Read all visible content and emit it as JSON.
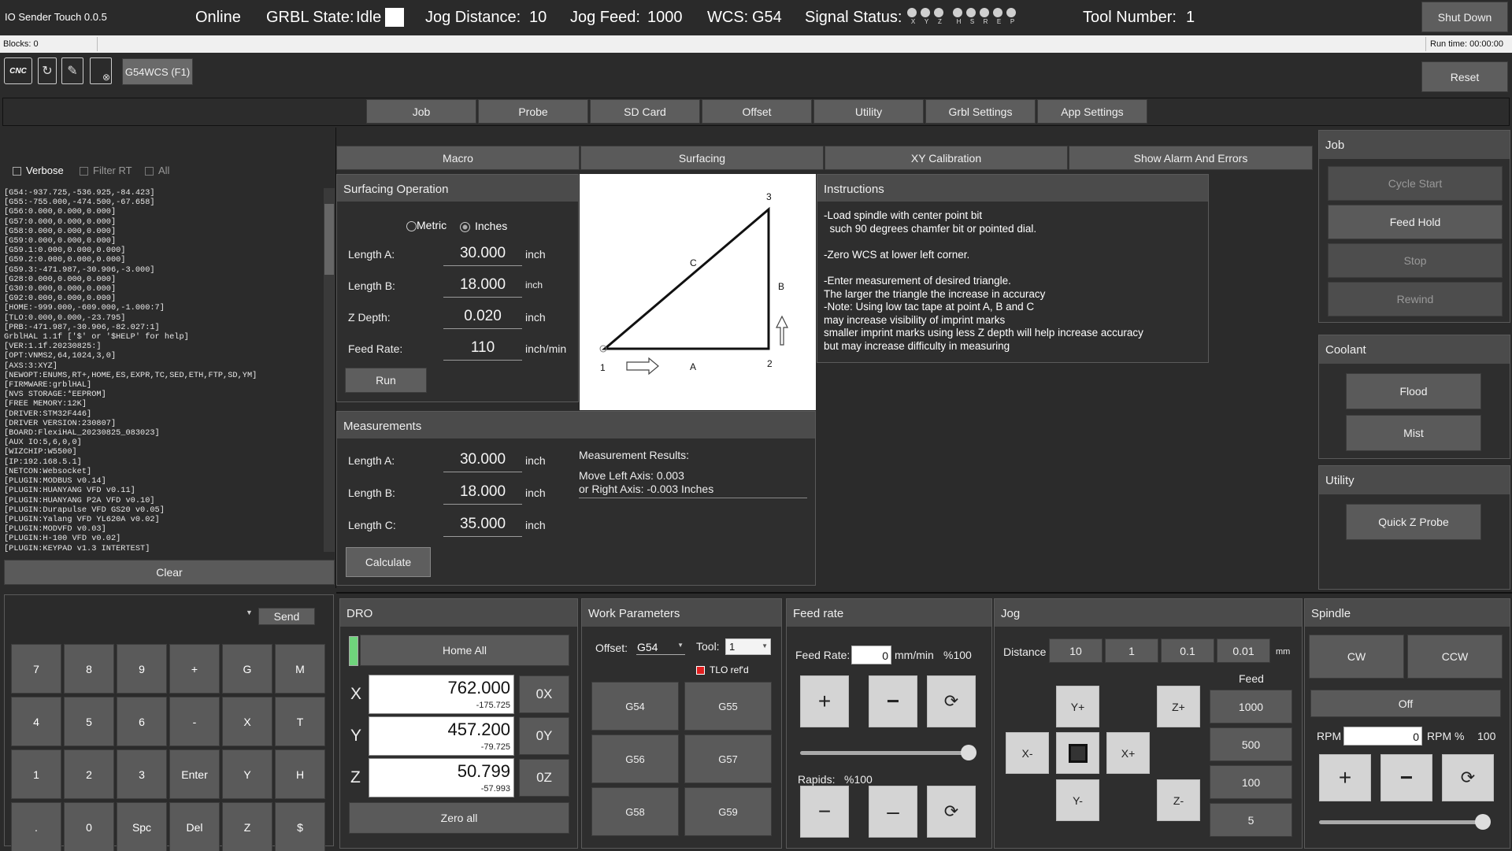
{
  "title_bar": {
    "app_title": "IO Sender Touch 0.0.5",
    "status": "Online",
    "grbl_label": "GRBL State:",
    "grbl_state": "Idle",
    "jog_dist_label": "Jog Distance:",
    "jog_dist": "10",
    "jog_feed_label": "Jog Feed:",
    "jog_feed": "1000",
    "wcs_label": "WCS:",
    "wcs": "G54",
    "signal_label": "Signal Status:",
    "signals_a": [
      "X",
      "Y",
      "Z"
    ],
    "signals_b": [
      "H",
      "S",
      "R",
      "E",
      "P"
    ],
    "tool_label": "Tool Number:",
    "tool": "1",
    "shutdown": "Shut Down"
  },
  "status_bar": {
    "blocks": "Blocks: 0",
    "runtime": "Run time: 00:00:00"
  },
  "toolbar": {
    "cnc_icon_text": "CNC",
    "wcs_button": "G54WCS (F1)",
    "reset": "Reset"
  },
  "main_tabs": [
    "Job",
    "Probe",
    "SD Card",
    "Offset",
    "Utility",
    "Grbl Settings",
    "App Settings"
  ],
  "sub_tabs": [
    "Macro",
    "Surfacing",
    "XY Calibration",
    "Show Alarm And Errors"
  ],
  "console": {
    "verbose": "Verbose",
    "filter": "Filter RT",
    "all": "All",
    "clear": "Clear",
    "send": "Send",
    "lines": [
      "[G54:-937.725,-536.925,-84.423]",
      "[G55:-755.000,-474.500,-67.658]",
      "[G56:0.000,0.000,0.000]",
      "[G57:0.000,0.000,0.000]",
      "[G58:0.000,0.000,0.000]",
      "[G59:0.000,0.000,0.000]",
      "[G59.1:0.000,0.000,0.000]",
      "[G59.2:0.000,0.000,0.000]",
      "[G59.3:-471.987,-30.906,-3.000]",
      "[G28:0.000,0.000,0.000]",
      "[G30:0.000,0.000,0.000]",
      "[G92:0.000,0.000,0.000]",
      "[HOME:-999.000,-609.000,-1.000:7]",
      "[TLO:0.000,0.000,-23.795]",
      "[PRB:-471.987,-30.906,-82.027:1]",
      "GrblHAL 1.1f ['$' or '$HELP' for help]",
      "[VER:1.1f.20230825:]",
      "[OPT:VNMS2,64,1024,3,0]",
      "[AXS:3:XYZ]",
      "[NEWOPT:ENUMS,RT+,HOME,ES,EXPR,TC,SED,ETH,FTP,SD,YM]",
      "[FIRMWARE:grblHAL]",
      "[NVS STORAGE:*EEPROM]",
      "[FREE MEMORY:12K]",
      "[DRIVER:STM32F446]",
      "[DRIVER VERSION:230807]",
      "[BOARD:FlexiHAL_20230825_083023]",
      "[AUX IO:5,6,0,0]",
      "[WIZCHIP:W5500]",
      "[IP:192.168.5.1]",
      "[NETCON:Websocket]",
      "[PLUGIN:MODBUS v0.14]",
      "[PLUGIN:HUANYANG VFD v0.11]",
      "[PLUGIN:HUANYANG P2A VFD v0.10]",
      "[PLUGIN:Durapulse VFD GS20 v0.05]",
      "[PLUGIN:Yalang VFD YL620A v0.02]",
      "[PLUGIN:MODVFD v0.03]",
      "[PLUGIN:H-100 VFD v0.02]",
      "[PLUGIN:KEYPAD v1.3 INTERTEST]"
    ]
  },
  "keypad": [
    "7",
    "8",
    "9",
    "+",
    "G",
    "M",
    "4",
    "5",
    "6",
    "-",
    "X",
    "T",
    "1",
    "2",
    "3",
    "Enter",
    "Y",
    "H",
    ".",
    "0",
    "Spc",
    "Del",
    "Z",
    "$"
  ],
  "surfacing": {
    "title": "Surfacing Operation",
    "metric": "Metric",
    "inches": "Inches",
    "fields": [
      {
        "label": "Length A:",
        "value": "30.000",
        "unit": "inch"
      },
      {
        "label": "Length B:",
        "value": "18.000",
        "unit": "inch"
      },
      {
        "label": "Z Depth:",
        "value": "0.020",
        "unit": "inch"
      },
      {
        "label": "Feed Rate:",
        "value": "110",
        "unit": "inch/min"
      }
    ],
    "run": "Run"
  },
  "diagram": {
    "p1": "1",
    "p2": "2",
    "p3": "3",
    "a": "A",
    "b": "B",
    "c": "C"
  },
  "instructions": {
    "title": "Instructions",
    "lines": [
      "-Load spindle with center point bit",
      "  such 90 degrees chamfer bit or pointed dial.",
      "",
      "-Zero WCS at lower left corner.",
      "",
      "-Enter measurement of desired triangle.",
      "The larger the triangle the increase in accuracy",
      "-Note: Using low tac tape at point A, B and C",
      "may increase visibility of imprint marks",
      "smaller imprint marks using less Z depth will help increase accuracy",
      "but may increase difficulty in measuring"
    ]
  },
  "measurements": {
    "title": "Measurements",
    "fields": [
      {
        "label": "Length A:",
        "value": "30.000",
        "unit": "inch"
      },
      {
        "label": "Length B:",
        "value": "18.000",
        "unit": "inch"
      },
      {
        "label": "Length C:",
        "value": "35.000",
        "unit": "inch"
      }
    ],
    "calculate": "Calculate",
    "results_title": "Measurement Results:",
    "result1": "Move Left Axis: 0.003",
    "result2": " or Right Axis: -0.003 Inches"
  },
  "job_panel": {
    "title": "Job",
    "cycle_start": "Cycle Start",
    "feed_hold": "Feed Hold",
    "stop": "Stop",
    "rewind": "Rewind"
  },
  "coolant_panel": {
    "title": "Coolant",
    "flood": "Flood",
    "mist": "Mist"
  },
  "utility_panel": {
    "title": "Utility",
    "quick_z": "Quick Z Probe"
  },
  "dro": {
    "title": "DRO",
    "home_all": "Home All",
    "zero_all": "Zero all",
    "axes": [
      {
        "name": "X",
        "value": "762.000",
        "sub": "-175.725",
        "zero": "0X"
      },
      {
        "name": "Y",
        "value": "457.200",
        "sub": "-79.725",
        "zero": "0Y"
      },
      {
        "name": "Z",
        "value": "50.799",
        "sub": "-57.993",
        "zero": "0Z"
      }
    ]
  },
  "work_params": {
    "title": "Work Parameters",
    "offset_label": "Offset:",
    "offset": "G54",
    "tool_label": "Tool:",
    "tool": "1",
    "tlo": "TLO ref'd",
    "buttons": [
      "G54",
      "G55",
      "G56",
      "G57",
      "G58",
      "G59"
    ],
    "tlo_color": "#e02020"
  },
  "feedrate": {
    "title": "Feed rate",
    "label": "Feed Rate:",
    "value": "0",
    "unit": "mm/min",
    "pct": "%100",
    "rapids_label": "Rapids:",
    "rapids_pct": "%100",
    "slider_level": 1.0
  },
  "jog": {
    "title": "Jog",
    "distance_label": "Distance",
    "distances": [
      "10",
      "1",
      "0.1",
      "0.01"
    ],
    "unit": "mm",
    "feed_label": "Feed",
    "feeds": [
      "1000",
      "500",
      "100",
      "5"
    ],
    "yplus": "Y+",
    "yminus": "Y-",
    "xminus": "X-",
    "xplus": "X+",
    "zplus": "Z+",
    "zminus": "Z-"
  },
  "spindle": {
    "title": "Spindle",
    "cw": "CW",
    "ccw": "CCW",
    "off": "Off",
    "rpm_label": "RPM",
    "rpm": "0",
    "rpm_pct_label": "RPM %",
    "rpm_pct": "100",
    "slider_level": 1.0
  }
}
